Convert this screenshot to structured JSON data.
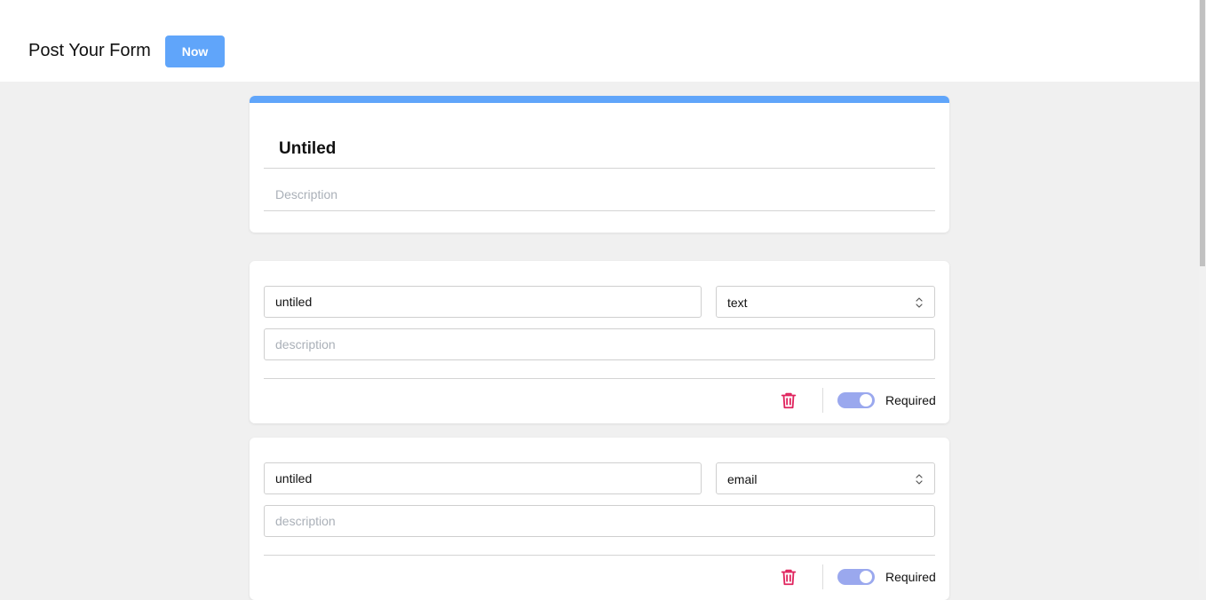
{
  "header": {
    "title": "Post Your Form",
    "now_button": "Now"
  },
  "form": {
    "title": "Untiled",
    "description_placeholder": "Description"
  },
  "questions": [
    {
      "title": "untiled",
      "type": "text",
      "description_placeholder": "description",
      "required_label": "Required",
      "required": true
    },
    {
      "title": "untiled",
      "type": "email",
      "description_placeholder": "description",
      "required_label": "Required",
      "required": true
    }
  ],
  "icons": {
    "delete": "trash-icon",
    "select": "chevron-up-down-icon"
  },
  "colors": {
    "accent": "#60a5fa",
    "toggle_on": "#9aa8ee",
    "delete": "#e0245e"
  }
}
